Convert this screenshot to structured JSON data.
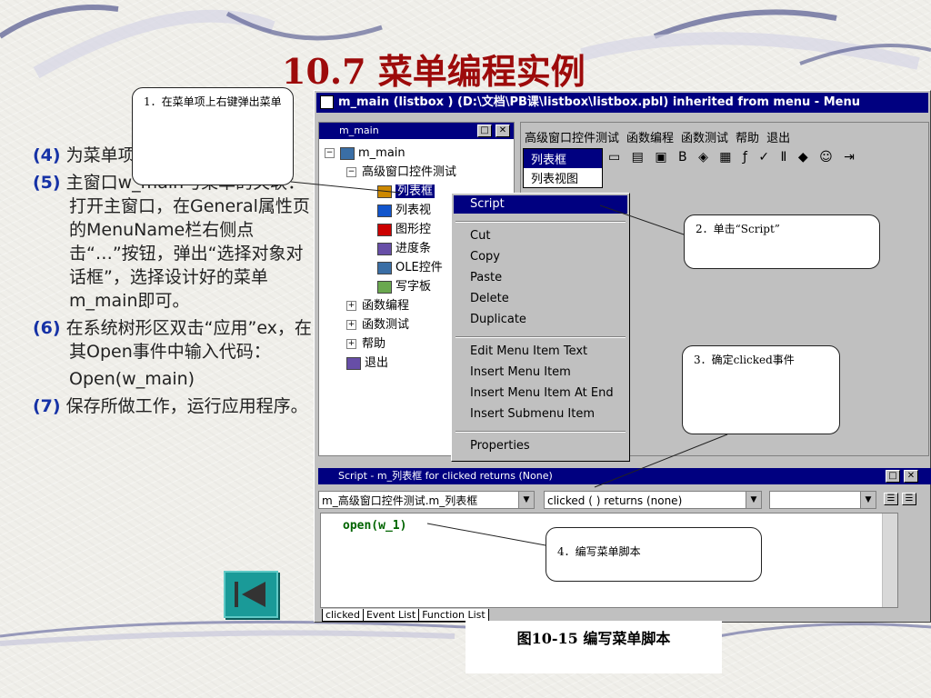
{
  "slide": {
    "title": "10.7 菜单编程实例",
    "bullets": [
      {
        "num": "(4)",
        "text": "为菜单项编写脚本"
      },
      {
        "num": "(5)",
        "text": "主窗口w_main与菜单的关联：打开主窗口，在General属性页的MenuName栏右侧点击“…”按钮，弹出“选择对象对话框”，选择设计好的菜单m_main即可。"
      },
      {
        "num": "(6)",
        "text": "在系统树形区双击“应用”ex，在其Open事件中输入代码："
      },
      {
        "num": "",
        "text": "Open(w_main)"
      },
      {
        "num": "(7)",
        "text": "保存所做工作，运行应用程序。"
      }
    ],
    "caption": "图10-15 编写菜单脚本"
  },
  "window": {
    "title": "m_main (listbox ) (D:\\文档\\PB课\\listbox\\listbox.pbl) inherited from menu - Menu",
    "tree_panel_title": "m_main",
    "tree": [
      {
        "label": "m_main",
        "level": 0,
        "expander": "−"
      },
      {
        "label": "高级窗口控件测试",
        "level": 1,
        "expander": "−"
      },
      {
        "label": "列表框",
        "level": 2,
        "expander": "",
        "selected": true
      },
      {
        "label": "列表视",
        "level": 2,
        "expander": ""
      },
      {
        "label": "图形控",
        "level": 2,
        "expander": ""
      },
      {
        "label": "进度条",
        "level": 2,
        "expander": ""
      },
      {
        "label": "OLE控件",
        "level": 2,
        "expander": ""
      },
      {
        "label": "写字板",
        "level": 2,
        "expander": ""
      },
      {
        "label": "函数编程",
        "level": 1,
        "expander": "+"
      },
      {
        "label": "函数测试",
        "level": 1,
        "expander": "+"
      },
      {
        "label": "帮助",
        "level": 1,
        "expander": "+"
      },
      {
        "label": "退出",
        "level": 1,
        "expander": ""
      }
    ],
    "menubar": [
      "高级窗口控件测试",
      "函数编程",
      "函数测试",
      "帮助",
      "退出"
    ],
    "dropdown": [
      "列表框",
      "列表视图"
    ],
    "context_menu": [
      {
        "label": "Script",
        "highlight": true
      },
      {
        "sep": true
      },
      {
        "label": "Cut"
      },
      {
        "label": "Copy"
      },
      {
        "label": "Paste"
      },
      {
        "label": "Delete"
      },
      {
        "label": "Duplicate"
      },
      {
        "sep": true
      },
      {
        "label": "Edit Menu Item Text"
      },
      {
        "label": "Insert Menu Item"
      },
      {
        "label": "Insert Menu Item At End"
      },
      {
        "label": "Insert Submenu Item"
      },
      {
        "sep": true
      },
      {
        "label": "Properties"
      }
    ],
    "script_title": "Script - m_列表框 for clicked returns (None)",
    "object_combo": "m_高级窗口控件测试.m_列表框",
    "event_combo": "clicked ( ) returns (none)",
    "code": "open(w_1)",
    "tabs": [
      "clicked",
      "Event List",
      "Function List"
    ]
  },
  "callouts": {
    "c1": "1．在菜单项上右键弹出菜单",
    "c2": "2．单击“Script”",
    "c3": "3．确定clicked事件",
    "c4": "4．编写菜单脚本"
  }
}
